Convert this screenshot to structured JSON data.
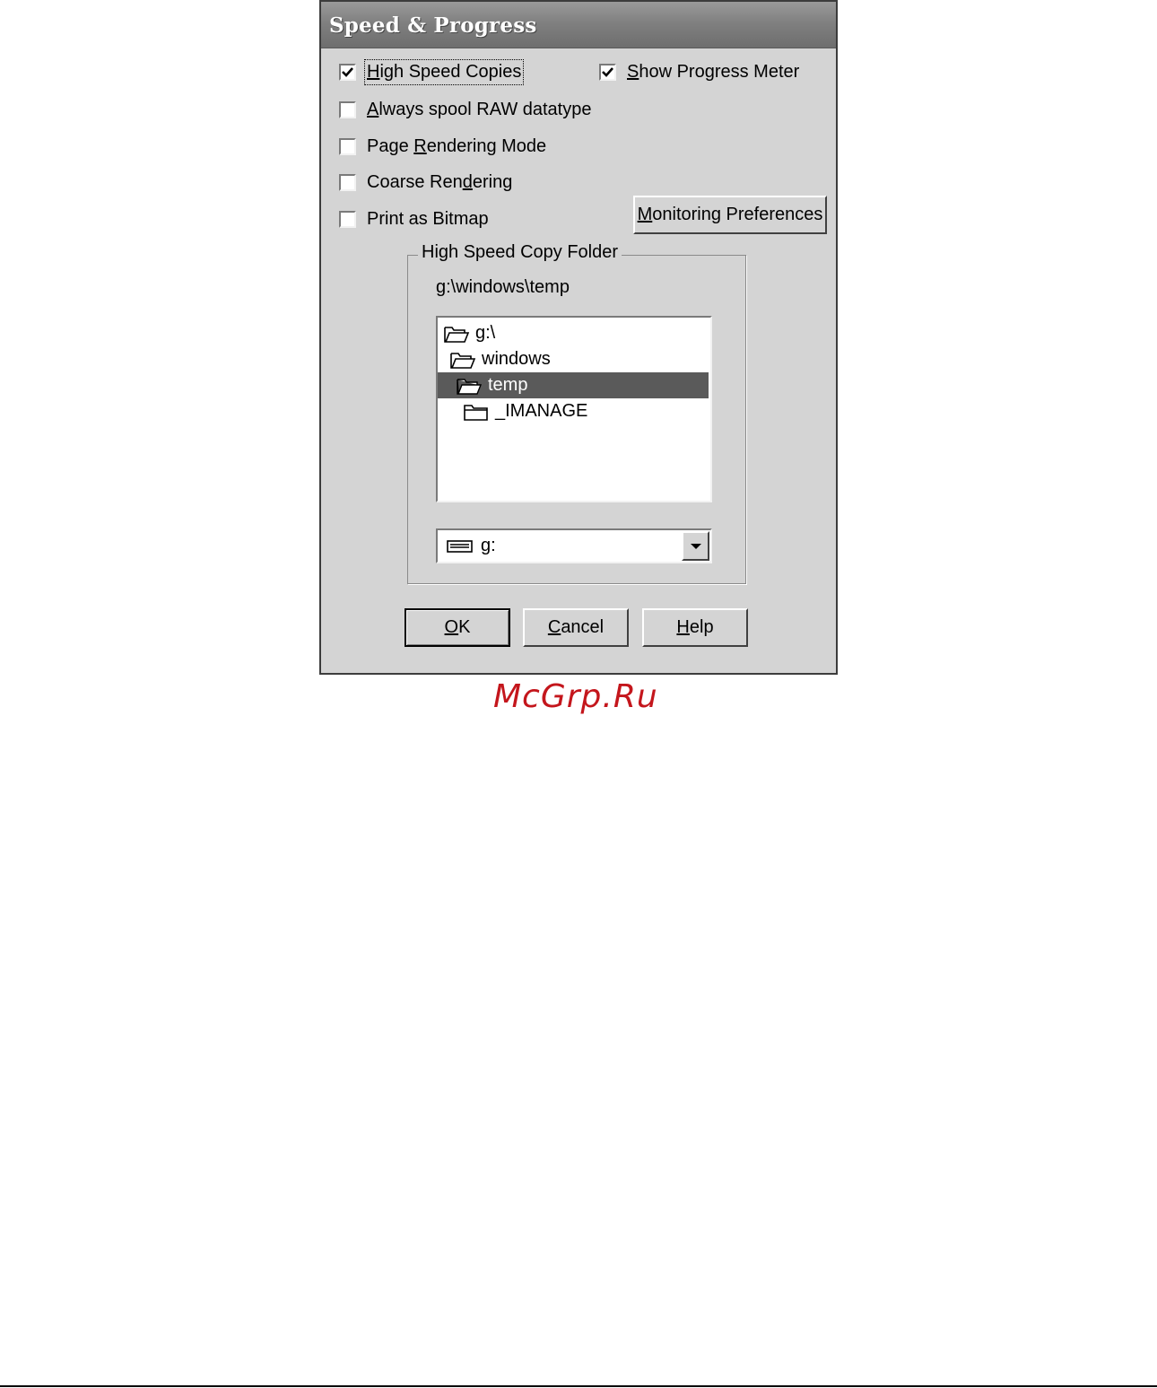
{
  "window": {
    "title": "Speed & Progress"
  },
  "options": {
    "high_speed_copies": {
      "label_pre": "",
      "label_key": "H",
      "label_post": "igh Speed Copies",
      "checked": true
    },
    "show_progress_meter": {
      "label_pre": "",
      "label_key": "S",
      "label_post": "how Progress Meter",
      "checked": true
    },
    "always_spool_raw": {
      "label_pre": "",
      "label_key": "A",
      "label_post": "lways spool RAW datatype",
      "checked": false
    },
    "page_rendering_mode": {
      "label_pre": "Page ",
      "label_key": "R",
      "label_post": "endering Mode",
      "checked": false
    },
    "coarse_rendering": {
      "label_pre": "Coarse Ren",
      "label_key": "d",
      "label_post": "ering",
      "checked": false
    },
    "print_as_bitmap": {
      "label_pre": "Print as Bitmap",
      "label_key": "",
      "label_post": "",
      "checked": false
    }
  },
  "monitoring_button": {
    "label_key": "M",
    "label_post": "onitoring Preferences"
  },
  "copy_folder": {
    "group_label": "High Speed Copy Folder",
    "current_path": "g:\\windows\\temp",
    "tree": [
      {
        "label": "g:\\",
        "icon": "open-folder-icon",
        "selected": false
      },
      {
        "label": "windows",
        "icon": "open-folder-icon",
        "selected": false
      },
      {
        "label": "temp",
        "icon": "open-folder-icon",
        "selected": true
      },
      {
        "label": "_IMANAGE",
        "icon": "closed-folder-icon",
        "selected": false
      }
    ],
    "drive": {
      "value": "g:",
      "icon": "drive-icon"
    }
  },
  "buttons": {
    "ok": {
      "label_key": "O",
      "label_post": "K"
    },
    "cancel": {
      "label_key": "C",
      "label_post": "ancel"
    },
    "help": {
      "label_key": "H",
      "label_post": "elp"
    }
  },
  "watermark": "McGrp.Ru",
  "colors": {
    "selection": "#5a5a5a",
    "dialog_bg": "#d4d4d4",
    "watermark": "#c4161c"
  }
}
